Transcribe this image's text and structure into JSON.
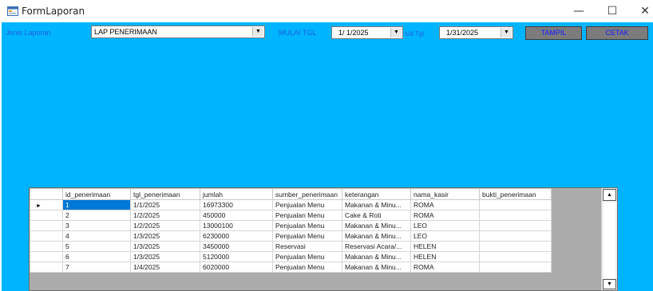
{
  "window": {
    "title": "FormLaporan",
    "minimize_glyph": "—",
    "maximize_glyph": "☐",
    "close_glyph": "✕"
  },
  "filters": {
    "jenis_label": "Jenis Laporan",
    "jenis_value": "LAP PENERIMAAN",
    "mulai_label": "MULAI TGL",
    "date_from": "1/ 1/2025",
    "sd_label": "s/d Tgl",
    "date_to": "1/31/2025",
    "dropdown_glyph": "▼"
  },
  "buttons": {
    "tampil": "TAMPIL",
    "cetak": "CETAK"
  },
  "grid": {
    "columns": [
      "id_penerimaan",
      "tgl_penerimaan",
      "jumlah",
      "sumber_penerimaan",
      "keterangan",
      "nama_kasir",
      "bukti_penerimaan"
    ],
    "rows": [
      [
        "1",
        "1/1/2025",
        "16973300",
        "Penjualan Menu",
        "Makanan & Minu...",
        "ROMA",
        ""
      ],
      [
        "2",
        "1/2/2025",
        "450000",
        "Penjualan Menu",
        "Cake & Roti",
        "ROMA",
        ""
      ],
      [
        "3",
        "1/2/2025",
        "13000100",
        "Penjualan Menu",
        "Makanan & Minu...",
        "LEO",
        ""
      ],
      [
        "4",
        "1/3/2025",
        "6230000",
        "Penjualan Menu",
        "Makanan & Minu...",
        "LEO",
        ""
      ],
      [
        "5",
        "1/3/2025",
        "3450000",
        "Reservasi",
        "Reservasi Acara/...",
        "HELEN",
        ""
      ],
      [
        "6",
        "1/3/2025",
        "5120000",
        "Penjualan Menu",
        "Makanan & Minu...",
        "HELEN",
        ""
      ],
      [
        "7",
        "1/4/2025",
        "6020000",
        "Penjualan Menu",
        "Makanan & Minu...",
        "ROMA",
        ""
      ]
    ],
    "current_row_glyph": "►",
    "scroll_up_glyph": "▲",
    "scroll_down_glyph": "▼"
  },
  "colors": {
    "client_background": "#00b4ff",
    "label_color": "#1f5fe0",
    "button_background": "#7c7c7c",
    "button_text": "#1a1aff",
    "selection": "#0078d7"
  },
  "icons": {
    "app": "form-window-icon"
  }
}
